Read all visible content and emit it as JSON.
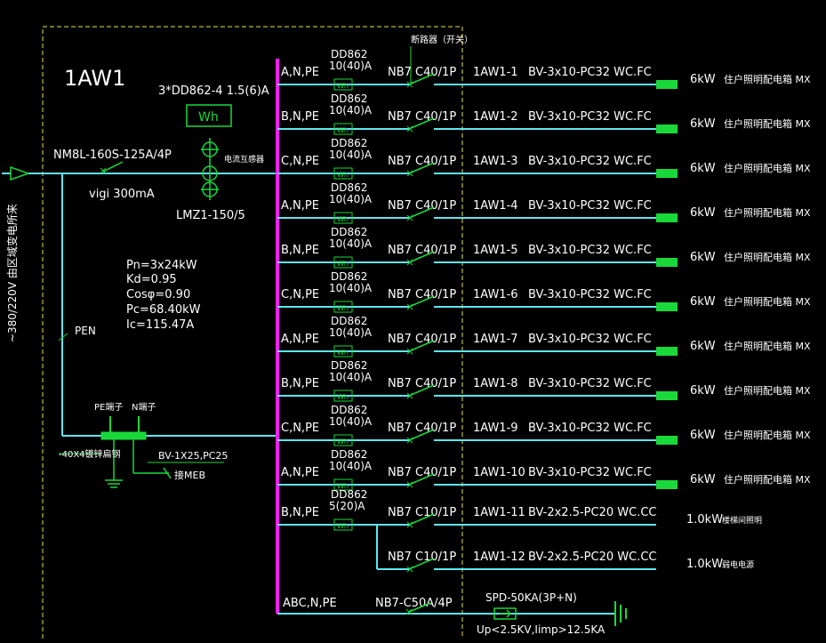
{
  "colors": {
    "background": "#000000",
    "wire": "#5ee6f0",
    "text": "#ffffff",
    "green": "#19d93a",
    "busbar": "#ff1aff",
    "panel_border": "#e6e05a",
    "label_green": "#33ff33"
  },
  "panel": {
    "title": "1AW1"
  },
  "incoming": {
    "supply_label": "~380/220V 由区域变电所来",
    "breaker": "NM8L-160S-125A/4P",
    "rcd": "vigi 300mA",
    "ct_label": "电流互感器",
    "ct_model": "LMZ1-150/5",
    "meter_title": "3*DD862-4 1.5(6)A",
    "meter_symbol": "Wh",
    "pen_label": "PEN",
    "pe_terminal": "PE端子",
    "n_terminal": "N端子",
    "ground_bar": "-40X4镀锌扁钢",
    "meb_cable": "BV-1X25,PC25",
    "meb_label": "接MEB"
  },
  "calc": {
    "lines": [
      "Pn=3x24kW",
      "Kd=0.95",
      "Cosφ=0.90",
      "Pc=68.40kW",
      "Ic=115.47A"
    ]
  },
  "breaker_note": "断路器（开关）",
  "meter_common": {
    "model": "DD862",
    "symbol": "Wh"
  },
  "circuits": [
    {
      "phase": "A,N,PE",
      "rating": "10(40)A",
      "breaker": "NB7 C40/1P",
      "id": "1AW1-1",
      "cable": "BV-3x10-PC32 WC.FC",
      "load": "6kW",
      "desc": "住户照明配电箱 MX"
    },
    {
      "phase": "B,N,PE",
      "rating": "10(40)A",
      "breaker": "NB7 C40/1P",
      "id": "1AW1-2",
      "cable": "BV-3x10-PC32 WC.FC",
      "load": "6kW",
      "desc": "住户照明配电箱 MX"
    },
    {
      "phase": "C,N,PE",
      "rating": "10(40)A",
      "breaker": "NB7 C40/1P",
      "id": "1AW1-3",
      "cable": "BV-3x10-PC32 WC.FC",
      "load": "6kW",
      "desc": "住户照明配电箱 MX"
    },
    {
      "phase": "A,N,PE",
      "rating": "10(40)A",
      "breaker": "NB7 C40/1P",
      "id": "1AW1-4",
      "cable": "BV-3x10-PC32 WC.FC",
      "load": "6kW",
      "desc": "住户照明配电箱 MX"
    },
    {
      "phase": "B,N,PE",
      "rating": "10(40)A",
      "breaker": "NB7 C40/1P",
      "id": "1AW1-5",
      "cable": "BV-3x10-PC32 WC.FC",
      "load": "6kW",
      "desc": "住户照明配电箱 MX"
    },
    {
      "phase": "C,N,PE",
      "rating": "10(40)A",
      "breaker": "NB7 C40/1P",
      "id": "1AW1-6",
      "cable": "BV-3x10-PC32 WC.FC",
      "load": "6kW",
      "desc": "住户照明配电箱 MX"
    },
    {
      "phase": "A,N,PE",
      "rating": "10(40)A",
      "breaker": "NB7 C40/1P",
      "id": "1AW1-7",
      "cable": "BV-3x10-PC32 WC.FC",
      "load": "6kW",
      "desc": "住户照明配电箱 MX"
    },
    {
      "phase": "B,N,PE",
      "rating": "10(40)A",
      "breaker": "NB7 C40/1P",
      "id": "1AW1-8",
      "cable": "BV-3x10-PC32 WC.FC",
      "load": "6kW",
      "desc": "住户照明配电箱 MX"
    },
    {
      "phase": "C,N,PE",
      "rating": "10(40)A",
      "breaker": "NB7 C40/1P",
      "id": "1AW1-9",
      "cable": "BV-3x10-PC32 WC.FC",
      "load": "6kW",
      "desc": "住户照明配电箱 MX"
    },
    {
      "phase": "A,N,PE",
      "rating": "10(40)A",
      "breaker": "NB7 C40/1P",
      "id": "1AW1-10",
      "cable": "BV-3x10-PC32 WC.FC",
      "load": "6kW",
      "desc": "住户照明配电箱 MX"
    },
    {
      "phase": "B,N,PE",
      "rating": "5(20)A",
      "breaker": "NB7 C10/1P",
      "id": "1AW1-11",
      "cable": "BV-2x2.5-PC20 WC.CC",
      "load": "1.0kW",
      "desc": "楼梯间照明"
    },
    {
      "phase": "",
      "rating": "",
      "breaker": "NB7 C10/1P",
      "id": "1AW1-12",
      "cable": "BV-2x2.5-PC20 WC.CC",
      "load": "1.0kW",
      "desc": "弱电电源"
    }
  ],
  "spd": {
    "phase": "ABC,N,PE",
    "breaker": "NB7-C50A/4P",
    "model": "SPD-50KA(3P+N)",
    "spec": "Up<2.5KV,Iimp>12.5KA"
  }
}
